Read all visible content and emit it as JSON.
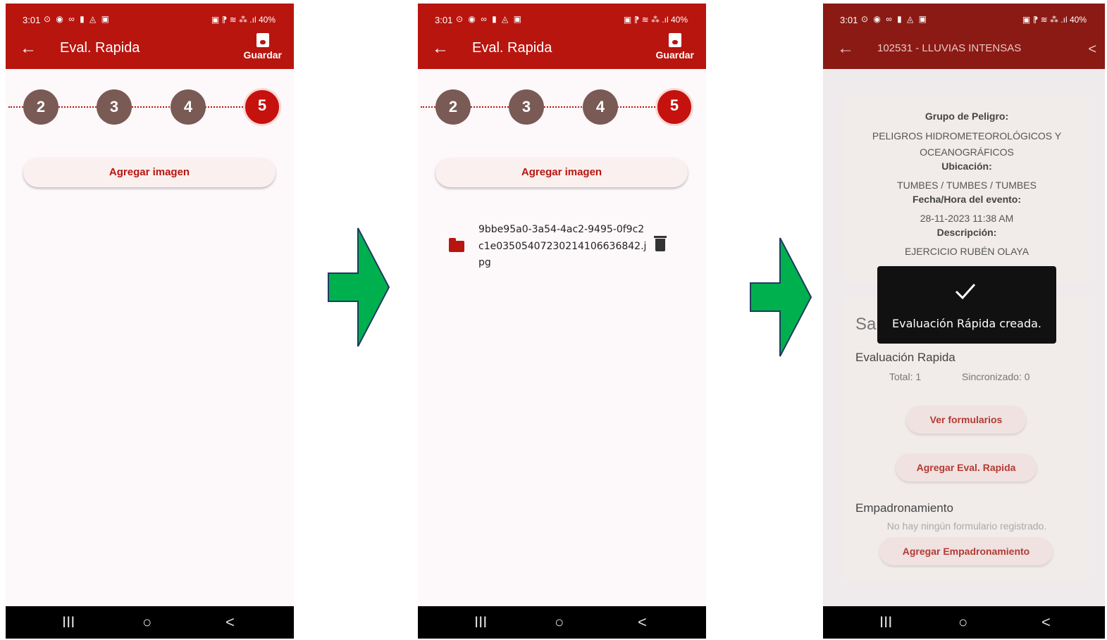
{
  "status": {
    "time": "3:01",
    "battery": "40%",
    "left_icons": "⊙ ◉ ∞ ▮ ◬ ▣",
    "right_icons": "▣ ⁋ ≋ ⁂ .ıl"
  },
  "screen1": {
    "title": "Eval. Rapida",
    "save_label": "Guardar",
    "steps": [
      "2",
      "3",
      "4",
      "5"
    ],
    "add_image": "Agregar imagen"
  },
  "screen2": {
    "title": "Eval. Rapida",
    "save_label": "Guardar",
    "steps": [
      "2",
      "3",
      "4",
      "5"
    ],
    "add_image": "Agregar imagen",
    "file_name": "9bbe95a0-3a54-4ac2-9495-0f9c2c1e03505407230214106636842.jpg"
  },
  "screen3": {
    "title": "102531 - LLUVIAS INTENSAS",
    "hazard_group_label": "Grupo de Peligro:",
    "hazard_group_value": "PELIGROS HIDROMETEOROLÓGICOS Y OCEANOGRÁFICOS",
    "location_label": "Ubicación:",
    "location_value": "TUMBES / TUMBES / TUMBES",
    "datetime_label": "Fecha/Hora del evento:",
    "datetime_value": "28-11-2023 11:38 AM",
    "description_label": "Descripción:",
    "description_value": "EJERCICIO RUBÉN OLAYA",
    "section_partial": "Sa",
    "eval_title": "Evaluación Rapida",
    "eval_total": "Total: 1",
    "eval_synced": "Sincronizado: 0",
    "view_forms": "Ver formularios",
    "add_eval": "Agregar Eval. Rapida",
    "registry_title": "Empadronamiento",
    "registry_empty": "No hay ningún formulario registrado.",
    "add_registry": "Agregar Empadronamiento",
    "toast": "Evaluación Rápida creada."
  },
  "nav": {
    "recent": "III",
    "home": "○",
    "back": "<"
  },
  "colors": {
    "primary": "#b8150f",
    "arrow": "#00b04f",
    "step_inactive": "#7a5a55"
  }
}
